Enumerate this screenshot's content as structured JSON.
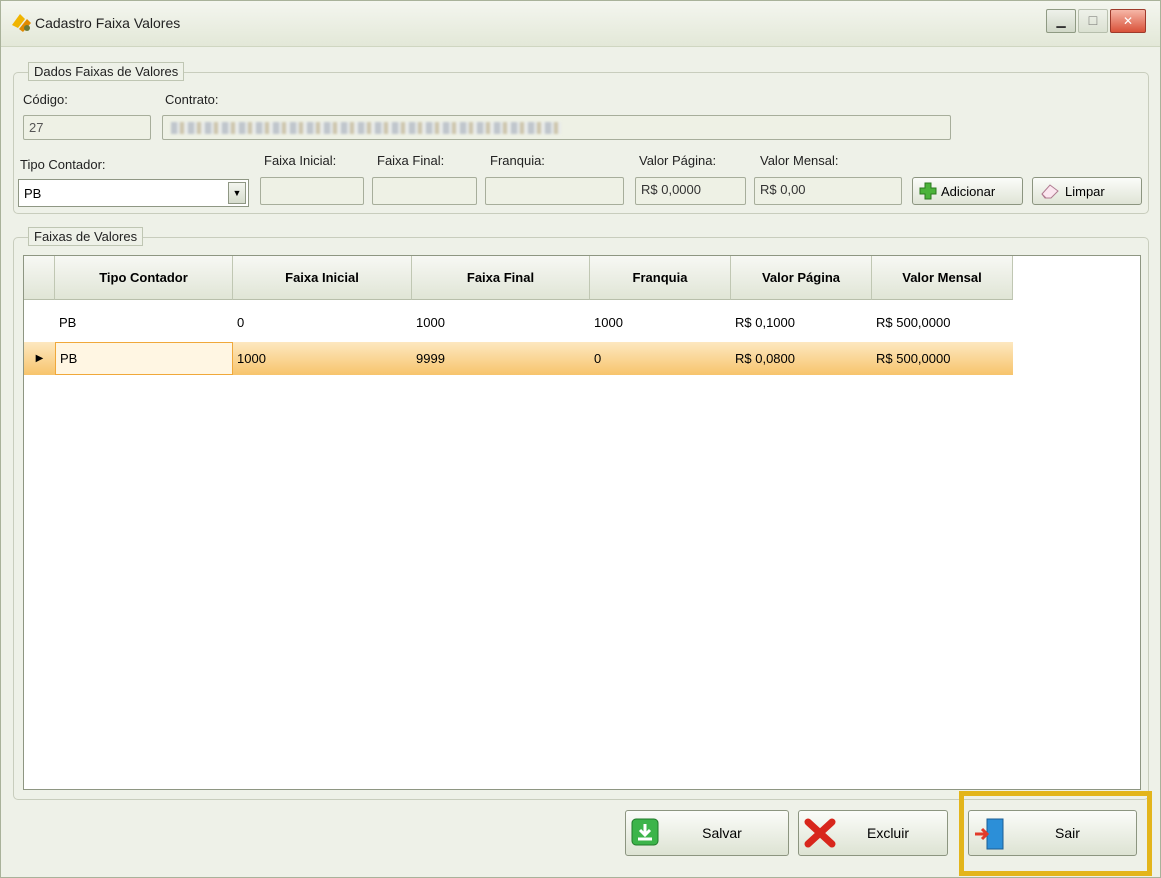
{
  "window": {
    "title": "Cadastro Faixa Valores"
  },
  "dados": {
    "legend": "Dados Faixas de Valores",
    "codigo_label": "Código:",
    "codigo_value": "27",
    "contrato_label": "Contrato:",
    "tipo_label": "Tipo Contador:",
    "tipo_value": "PB",
    "faixa_inicial_label": "Faixa Inicial:",
    "faixa_final_label": "Faixa Final:",
    "franquia_label": "Franquia:",
    "valor_pagina_label": "Valor Página:",
    "valor_pagina_value": "R$ 0,0000",
    "valor_mensal_label": "Valor Mensal:",
    "valor_mensal_value": "R$ 0,00",
    "adicionar_label": "Adicionar",
    "limpar_label": "Limpar"
  },
  "faixas": {
    "legend": "Faixas de Valores",
    "columns": [
      "Tipo Contador",
      "Faixa Inicial",
      "Faixa Final",
      "Franquia",
      "Valor Página",
      "Valor Mensal"
    ],
    "rows": [
      [
        "PB",
        "0",
        "1000",
        "1000",
        "R$ 0,1000",
        "R$ 500,0000"
      ],
      [
        "PB",
        "1000",
        "9999",
        "0",
        "R$ 0,0800",
        "R$ 500,0000"
      ]
    ],
    "selected_row": 1
  },
  "footer": {
    "salvar_label": "Salvar",
    "excluir_label": "Excluir",
    "sair_label": "Sair"
  }
}
